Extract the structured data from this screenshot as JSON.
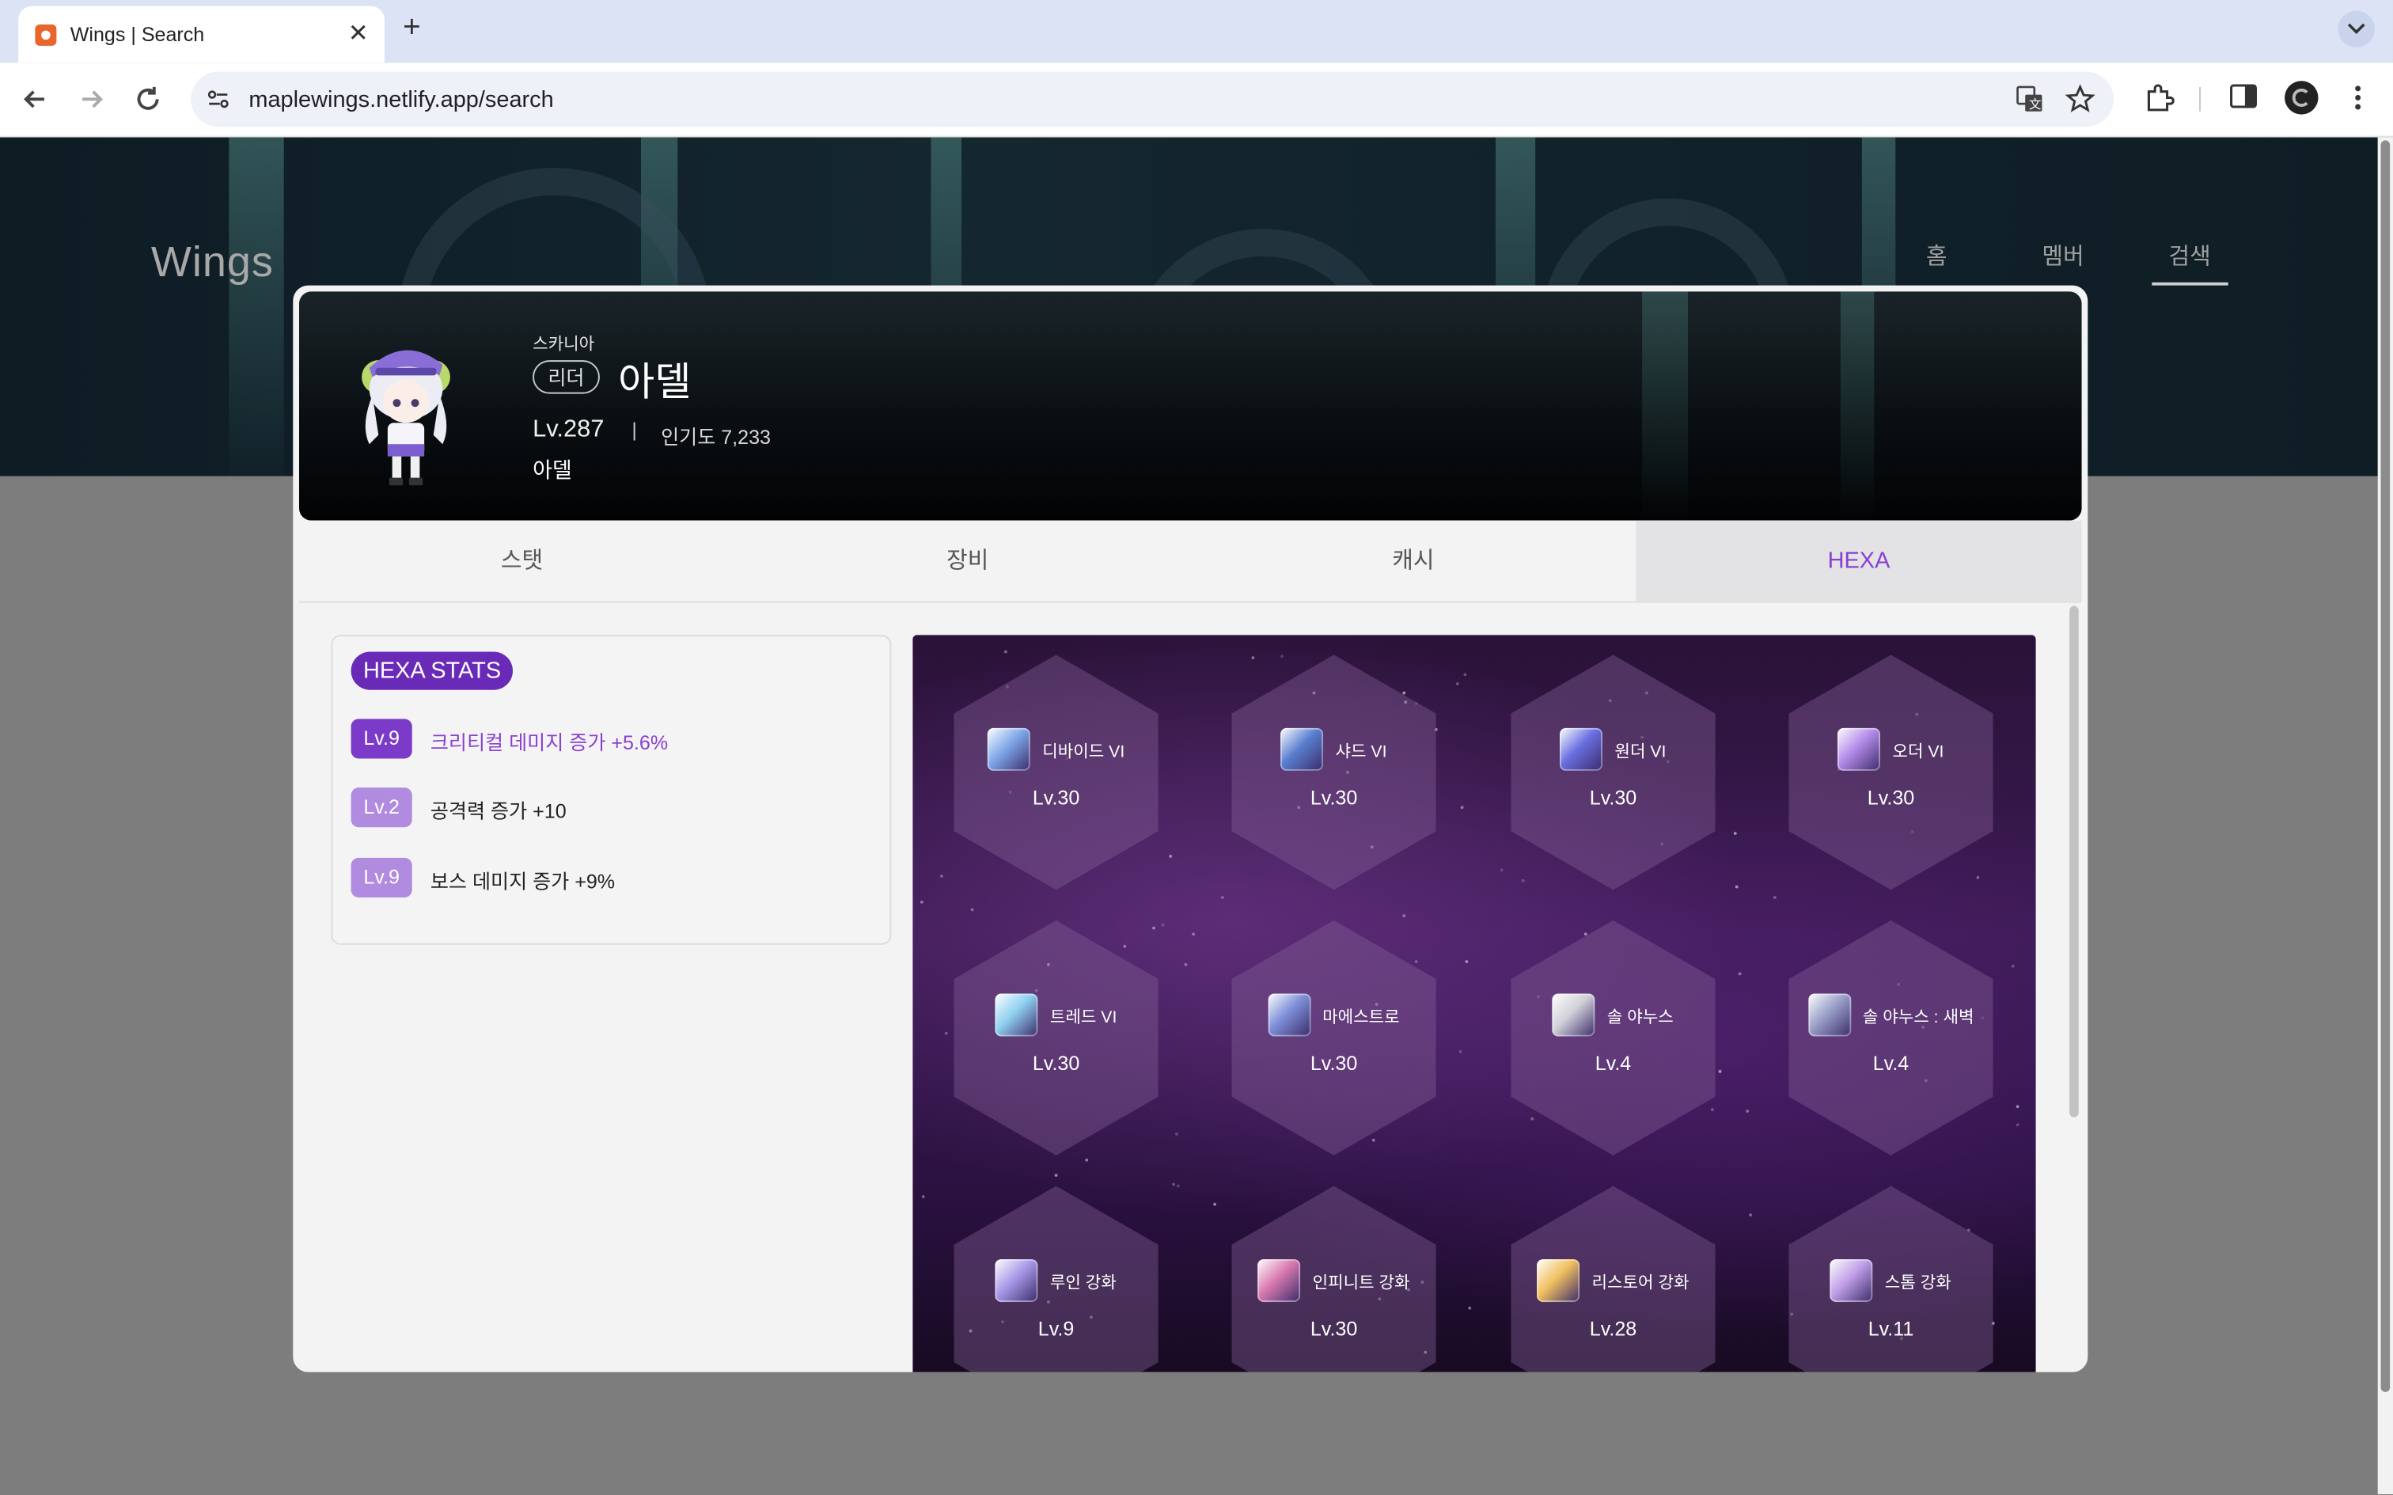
{
  "browser": {
    "tab_title": "Wings | Search",
    "url": "maplewings.netlify.app/search"
  },
  "site": {
    "logo": "Wings",
    "nav": [
      "홈",
      "멤버",
      "검색"
    ]
  },
  "profile": {
    "world": "스카니아",
    "badge": "리더",
    "name": "아델",
    "level": "Lv.287",
    "separator": "|",
    "fame": "인기도 7,233",
    "job": "아델"
  },
  "tabs": [
    "스탯",
    "장비",
    "캐시",
    "HEXA"
  ],
  "hexa_stats": {
    "title": "HEXA STATS",
    "rows": [
      {
        "level": "Lv.9",
        "text": "크리티컬 데미지 증가 +5.6%"
      },
      {
        "level": "Lv.2",
        "text": "공격력 증가 +10"
      },
      {
        "level": "Lv.9",
        "text": "보스 데미지 증가 +9%"
      }
    ]
  },
  "hexa_skills": [
    {
      "name": "디바이드 VI",
      "level": "Lv.30",
      "icon": "divide-icon",
      "color": "#7fa8e8"
    },
    {
      "name": "샤드 VI",
      "level": "Lv.30",
      "icon": "shard-icon",
      "color": "#5a7fd0"
    },
    {
      "name": "원더 VI",
      "level": "Lv.30",
      "icon": "wonder-icon",
      "color": "#6a6fe0"
    },
    {
      "name": "오더 VI",
      "level": "Lv.30",
      "icon": "order-icon",
      "color": "#b48ae8"
    },
    {
      "name": "트레드 VI",
      "level": "Lv.30",
      "icon": "tread-icon",
      "color": "#8fd0f0"
    },
    {
      "name": "마에스트로",
      "level": "Lv.30",
      "icon": "maestro-icon",
      "color": "#7d8fd8"
    },
    {
      "name": "솔 야누스",
      "level": "Lv.4",
      "icon": "sol-janus-icon",
      "color": "#d0d0d8"
    },
    {
      "name": "솔 야누스 : 새벽",
      "level": "Lv.4",
      "icon": "sol-janus-dawn-icon",
      "color": "#9aa0c8"
    },
    {
      "name": "루인 강화",
      "level": "Lv.9",
      "icon": "ruin-icon",
      "color": "#a89ae8"
    },
    {
      "name": "인피니트 강화",
      "level": "Lv.30",
      "icon": "infinite-icon",
      "color": "#d87ab0"
    },
    {
      "name": "리스토어 강화",
      "level": "Lv.28",
      "icon": "restore-icon",
      "color": "#f0c060"
    },
    {
      "name": "스톰 강화",
      "level": "Lv.11",
      "icon": "storm-icon",
      "color": "#c0a0e8"
    }
  ]
}
